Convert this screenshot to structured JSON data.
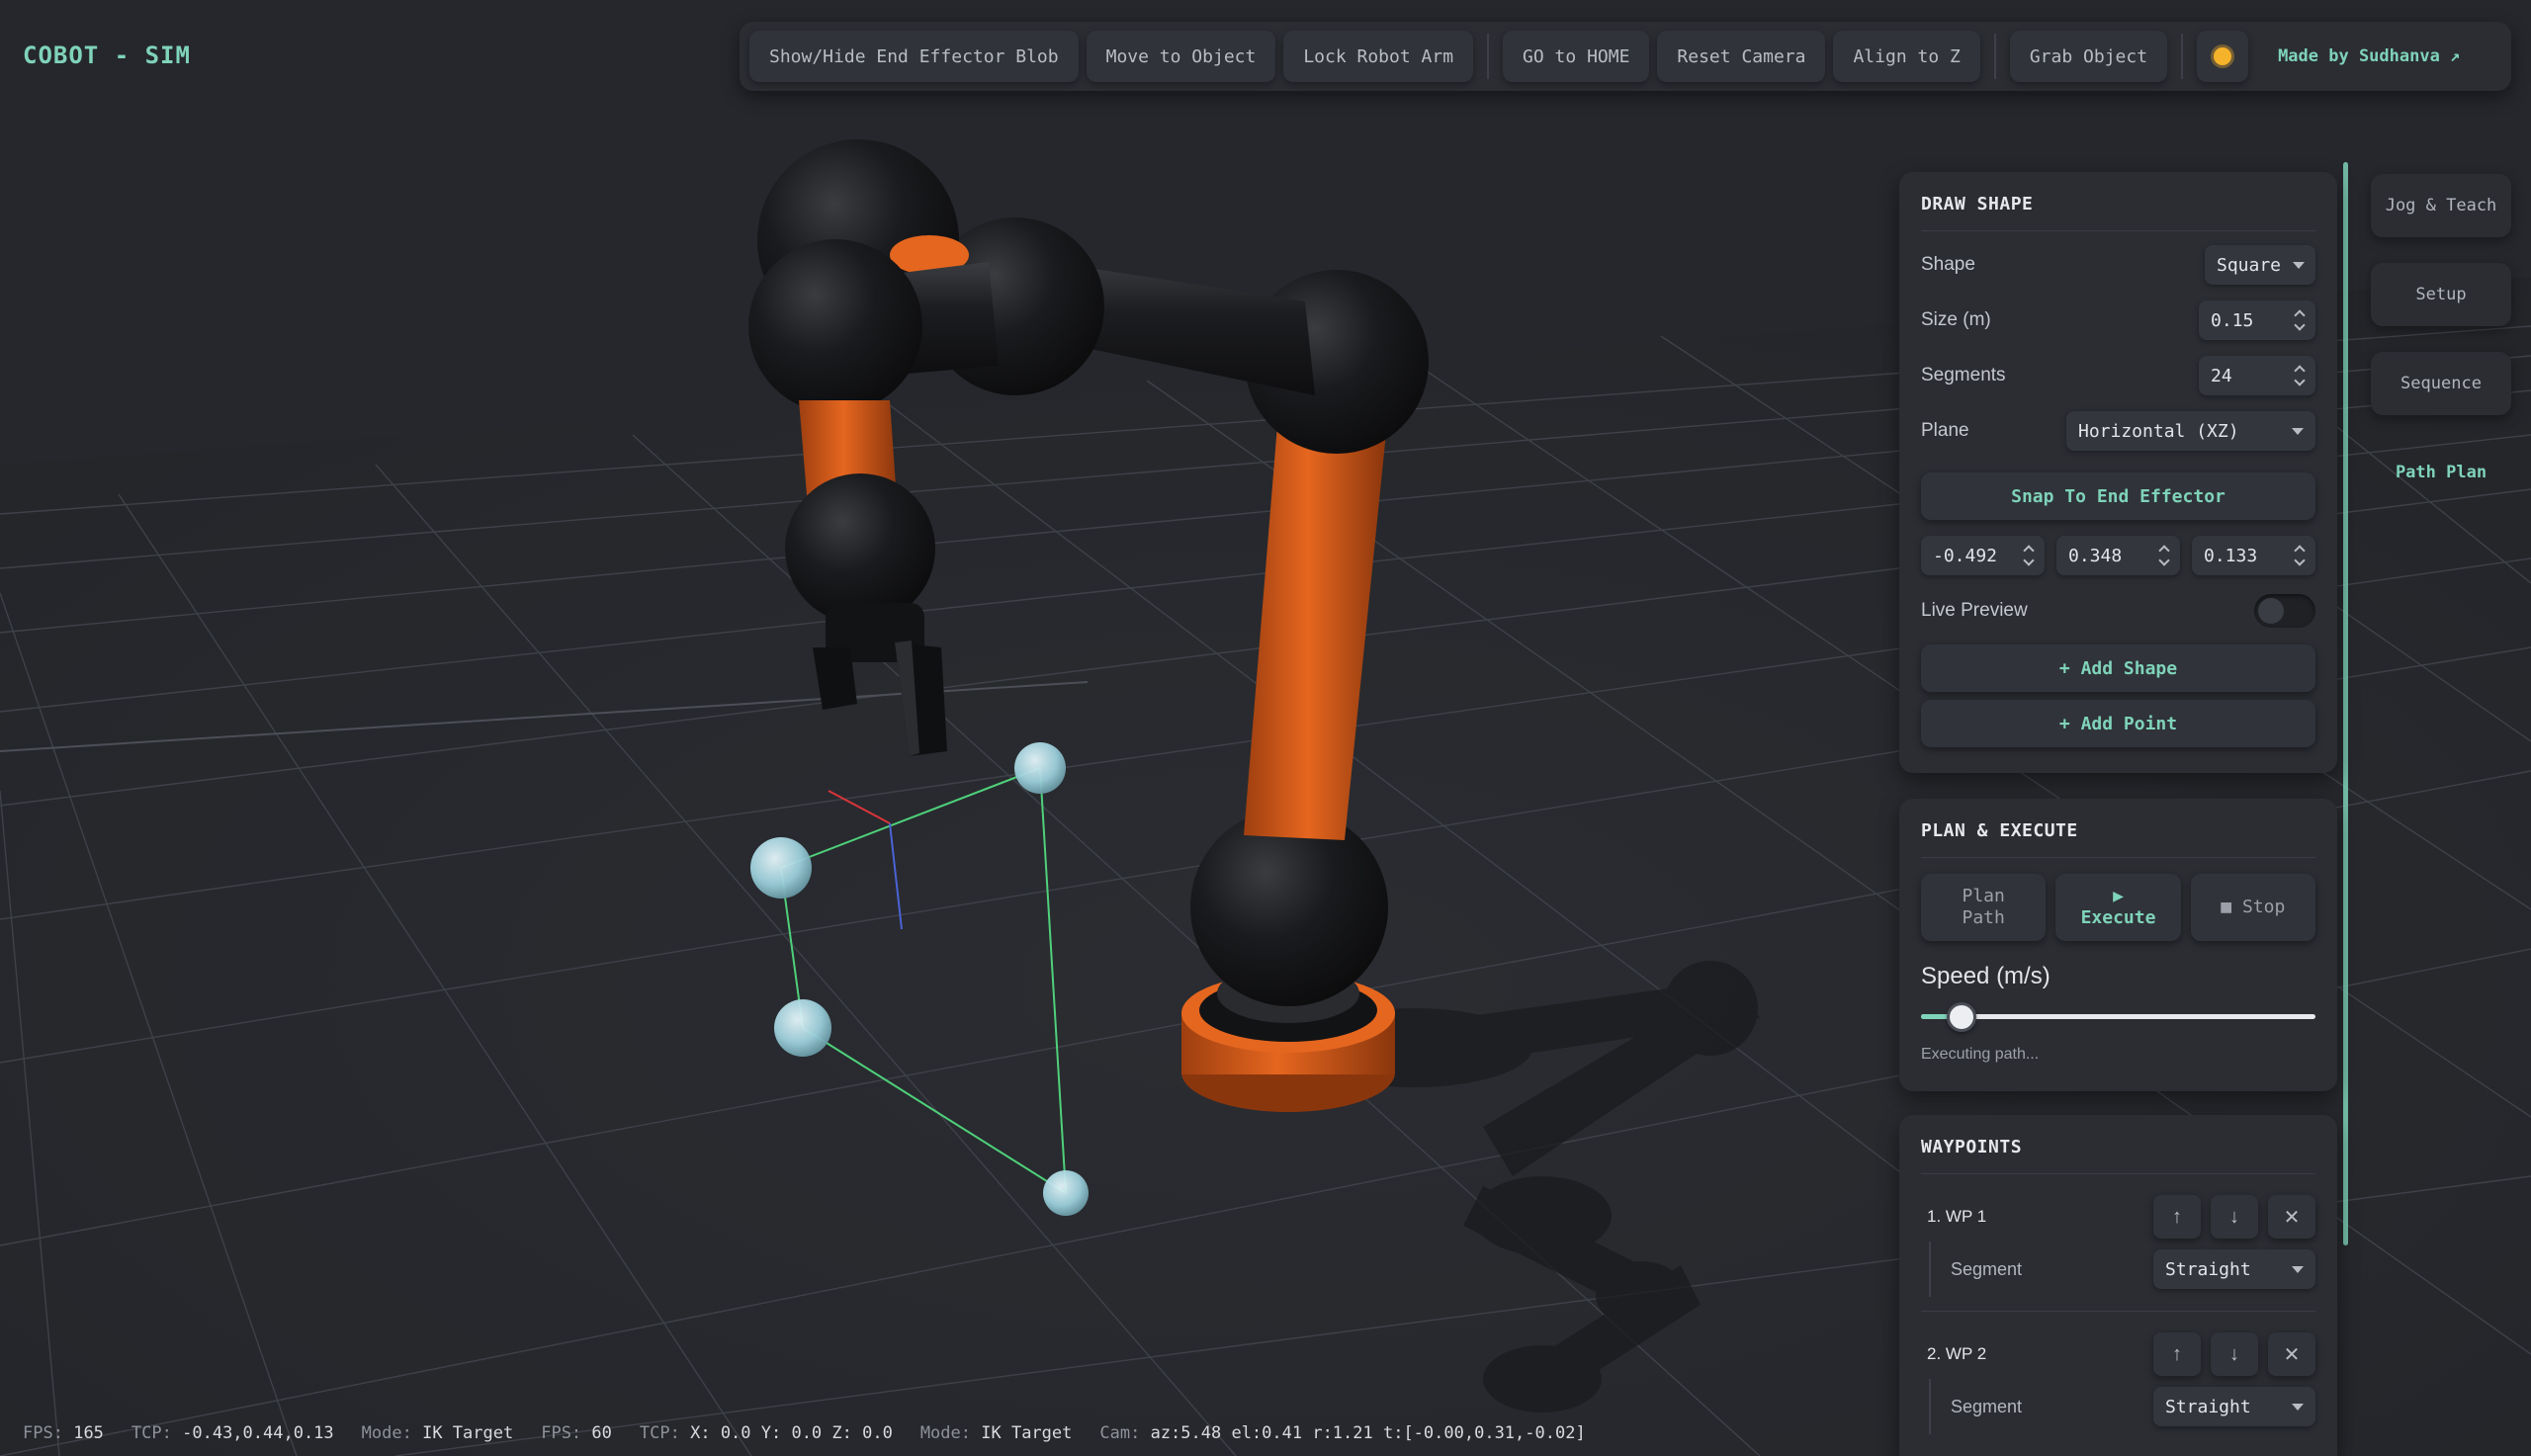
{
  "app": {
    "title": "COBOT - SIM"
  },
  "toolbar": {
    "buttons": [
      "Show/Hide End Effector Blob",
      "Move to Object",
      "Lock Robot Arm",
      "GO to HOME",
      "Reset Camera",
      "Align to Z",
      "Grab Object"
    ],
    "theme_icon": "sun-icon",
    "made_by": "Made by Sudhanva ↗"
  },
  "side_tabs": [
    "Jog & Teach",
    "Setup",
    "Sequence",
    "Path Plan"
  ],
  "active_tab": "Path Plan",
  "draw_shape": {
    "title": "DRAW SHAPE",
    "shape_label": "Shape",
    "shape_value": "Square",
    "size_label": "Size (m)",
    "size_value": "0.15",
    "segments_label": "Segments",
    "segments_value": "24",
    "plane_label": "Plane",
    "plane_value": "Horizontal (XZ)",
    "snap_button": "Snap To End Effector",
    "coords": [
      "-0.492",
      "0.348",
      "0.133"
    ],
    "live_preview_label": "Live Preview",
    "live_preview_on": false,
    "add_shape_button": "+ Add Shape",
    "add_point_button": "+ Add Point"
  },
  "plan_execute": {
    "title": "PLAN & EXECUTE",
    "plan_button_line1": "Plan",
    "plan_button_line2": "Path",
    "execute_icon": "▶",
    "execute_button": "Execute",
    "stop_button": "■ Stop",
    "speed_label": "Speed (m/s)",
    "speed_fraction": 0.07,
    "status": "Executing path..."
  },
  "waypoints": {
    "title": "WAYPOINTS",
    "segment_label": "Segment",
    "items": [
      {
        "name": "1. WP 1",
        "segment": "Straight"
      },
      {
        "name": "2. WP 2",
        "segment": "Straight"
      }
    ],
    "up_icon": "↑",
    "down_icon": "↓",
    "remove_icon": "✕"
  },
  "statusbar": {
    "fps1_label": "FPS:",
    "fps1": "165",
    "tcp1_label": "TCP:",
    "tcp1": "-0.43,0.44,0.13",
    "mode1_label": "Mode:",
    "mode1": "IK Target",
    "fps2_label": "FPS:",
    "fps2": "60",
    "tcp2_label": "TCP:",
    "tcp2": "X: 0.0 Y: 0.0 Z: 0.0",
    "mode2_label": "Mode:",
    "mode2": "IK Target",
    "cam_label": "Cam:",
    "cam": "az:5.48 el:0.41 r:1.21 t:[-0.00,0.31,-0.02]"
  },
  "colors": {
    "background": "#25272c",
    "accent": "#7fd3b9",
    "robot_orange": "#e0621f",
    "robot_black": "#151618",
    "path_line": "#4fd07a",
    "waypoint": "#a9dbe6"
  }
}
